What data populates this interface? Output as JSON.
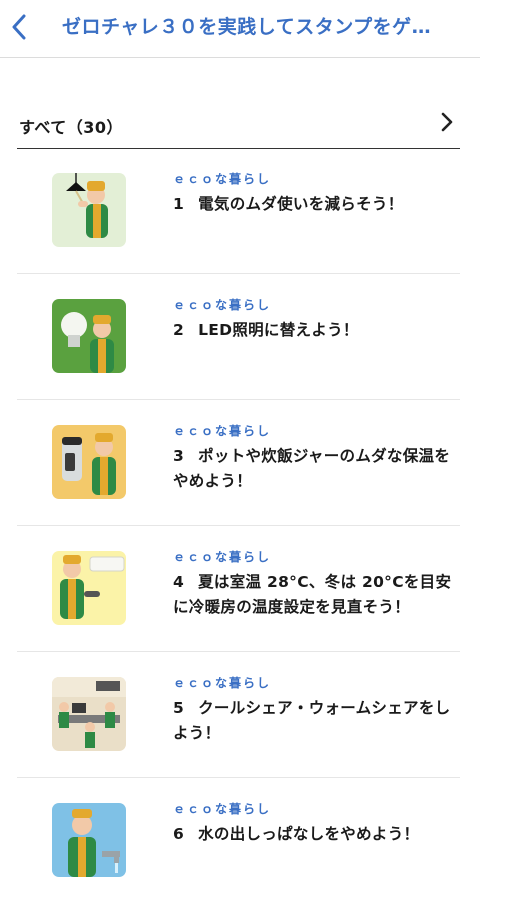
{
  "header": {
    "title": "ゼロチャレ３０を実践してスタンプをゲ…",
    "back_icon": "chevron-left-icon",
    "accent_color": "#3a6fc4"
  },
  "filter": {
    "label": "すべて（30）",
    "chevron_icon": "chevron-right-icon"
  },
  "items": [
    {
      "category": "ｅｃｏな暮らし",
      "number": "1",
      "title": "電気のムダ使いを減らそう！",
      "image": "lamp-thumbnail"
    },
    {
      "category": "ｅｃｏな暮らし",
      "number": "2",
      "title": "LED照明に替えよう！",
      "image": "led-bulb-thumbnail"
    },
    {
      "category": "ｅｃｏな暮らし",
      "number": "3",
      "title": "ポットや炊飯ジャーのムダな保温をやめよう！",
      "image": "thermos-thumbnail"
    },
    {
      "category": "ｅｃｏな暮らし",
      "number": "4",
      "title": "夏は室温 28°C、冬は 20°Cを目安に冷暖房の温度設定を見直そう！",
      "image": "air-conditioner-thumbnail"
    },
    {
      "category": "ｅｃｏな暮らし",
      "number": "5",
      "title": "クールシェア・ウォームシェアをしよう！",
      "image": "office-share-thumbnail"
    },
    {
      "category": "ｅｃｏな暮らし",
      "number": "6",
      "title": "水の出しっぱなしをやめよう！",
      "image": "faucet-thumbnail"
    }
  ]
}
